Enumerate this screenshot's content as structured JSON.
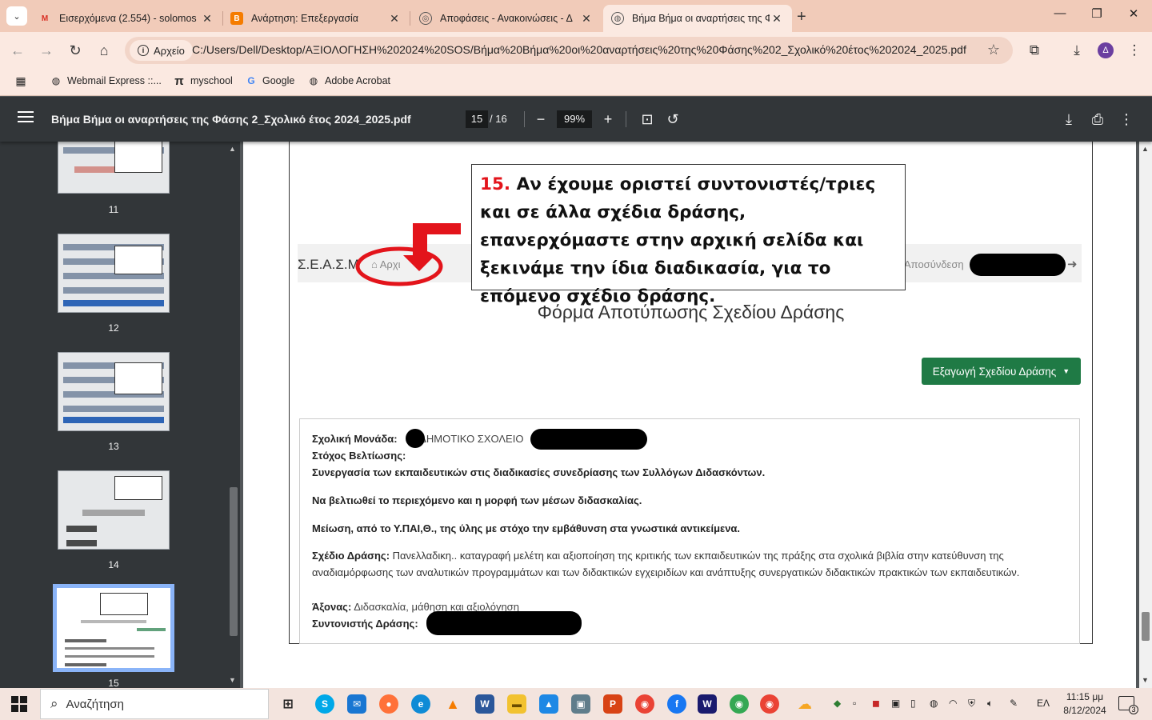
{
  "browser": {
    "tabs": [
      {
        "title": "Εισερχόμενα (2.554) - solomos",
        "icon": "gmail-icon",
        "active": false
      },
      {
        "title": "Ανάρτηση: Επεξεργασία",
        "icon": "blogger-icon",
        "active": false
      },
      {
        "title": "Αποφάσεις - Ανακοινώσεις - Δ",
        "icon": "web-icon",
        "active": false
      },
      {
        "title": "Βήμα Βήμα οι αναρτήσεις της Φ",
        "icon": "globe-icon",
        "active": true
      }
    ],
    "site_chip": "Αρχείο",
    "url": "C:/Users/Dell/Desktop/ΑΞΙΟΛΟΓΗΣΗ%202024%20SOS/Βήμα%20Βήμα%20οι%20αναρτήσεις%20της%20Φάσης%202_Σχολικό%20έτος%202024_2025.pdf",
    "profile_initial": "Δ",
    "bookmarks": [
      {
        "label": "Webmail Express ::...",
        "icon": "globe-icon"
      },
      {
        "label": "myschool",
        "icon": "pi-icon"
      },
      {
        "label": "Google",
        "icon": "google-icon"
      },
      {
        "label": "Adobe Acrobat",
        "icon": "globe-icon"
      }
    ]
  },
  "pdf": {
    "title": "Βήμα Βήμα οι αναρτήσεις της Φάσης 2_Σχολικό έτος 2024_2025.pdf",
    "current_page": "15",
    "total_pages": "/ 16",
    "zoom": "99%",
    "thumbnails": [
      "11",
      "12",
      "13",
      "14",
      "15"
    ],
    "selected_thumbnail": "15"
  },
  "page_content": {
    "callout_number": "15.",
    "callout_text": "Αν έχουμε οριστεί συντονιστές/τριες και σε άλλα σχέδια δράσης, επανερχόμαστε στην αρχική σελίδα και ξεκινάμε την ίδια διαδικασία, για το επόμενο σχέδιο δράσης.",
    "site_brand": "Σ.Ε.Α.Σ.Μ",
    "home_link": "Αρχι",
    "logout": "Αποσύνδεση",
    "form_title": "Φόρμα Αποτύπωσης Σχεδίου Δράσης",
    "export_button": "Εξαγωγή Σχεδίου Δράσης",
    "school_label": "Σχολική Μονάδα:",
    "school_value": "ΔΗΜΟΤΙΚΟ ΣΧΟΛΕΙΟ",
    "goal_label": "Στόχος Βελτίωσης:",
    "goal_1": "Συνεργασία των εκπαιδευτικών στις διαδικασίες συνεδρίασης των Συλλόγων Διδασκόντων.",
    "goal_2": "Να βελτιωθεί το  περιεχόμενο και η μορφή  των μέσων διδασκαλίας.",
    "goal_3": "Μείωση, από το Υ.ΠΑΙ,Θ., της ύλης με στόχο την εμβάθυνση στα γνωστικά αντικείμενα.",
    "plan_label": "Σχέδιο Δράσης:",
    "plan_value": "Πανελλαδικη.. καταγραφή μελέτη και αξιοποίηση της κριτικής των εκπαιδευτικών της πράξης στα σχολικά βιβλία στην κατεύθυνση της αναδιαμόρφωσης των αναλυτικών προγραμμάτων και των διδακτικών εγχειριδίων και ανάπτυξης συνεργατικών διδακτικών πρακτικών των εκπαιδευτικών.",
    "axis_label": "Άξονας:",
    "axis_value": "Διδασκαλία, μάθηση και αξιολόγηση",
    "coordinator_label": "Συντονιστής Δράσης:"
  },
  "taskbar": {
    "search_placeholder": "Αναζήτηση",
    "language": "ΕΛ",
    "time": "11:15 μμ",
    "date": "8/12/2024",
    "notification_count": "3"
  },
  "colors": {
    "tab_bar": "#f1cbb9",
    "toolbar": "#fbe9e1",
    "pdf_toolbar": "#323639",
    "callout_number": "#e3141b",
    "export_button": "#1f7a45",
    "thumbnail_highlight": "#8ab4f8"
  }
}
